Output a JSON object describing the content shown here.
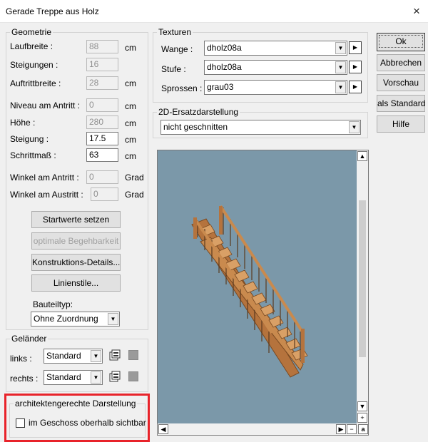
{
  "window": {
    "title": "Gerade Treppe aus Holz",
    "close_glyph": "×"
  },
  "geometrie": {
    "legend": "Geometrie",
    "laufbreite": {
      "label": "Laufbreite :",
      "value": "88",
      "unit": "cm"
    },
    "steigungen": {
      "label": "Steigungen :",
      "value": "16"
    },
    "auftrittbreite": {
      "label": "Auftrittbreite :",
      "value": "28",
      "unit": "cm"
    },
    "niveau": {
      "label": "Niveau am Antritt :",
      "value": "0",
      "unit": "cm"
    },
    "hoehe": {
      "label": "Höhe :",
      "value": "280",
      "unit": "cm"
    },
    "steigung": {
      "label": "Steigung :",
      "value": "17.5",
      "unit": "cm"
    },
    "schrittmass": {
      "label": "Schrittmaß :",
      "value": "63",
      "unit": "cm"
    },
    "winkel_antritt": {
      "label": "Winkel am Antritt :",
      "value": "0",
      "unit": "Grad"
    },
    "winkel_austritt": {
      "label": "Winkel am Austritt :",
      "value": "0",
      "unit": "Grad"
    },
    "startwerte_label": "Startwerte setzen",
    "begehbarkeit_label": "optimale Begehbarkeit",
    "konstruktion_label": "Konstruktions-Details...",
    "linienstile_label": "Linienstile...",
    "bauteiltyp_label": "Bauteiltyp:",
    "bauteiltyp_value": "Ohne Zuordnung"
  },
  "gelaender": {
    "legend": "Geländer",
    "links_label": "links :",
    "links_value": "Standard",
    "rechts_label": "rechts :",
    "rechts_value": "Standard"
  },
  "architekten": {
    "legend": "architektengerechte Darstellung",
    "checkbox_label": "im Geschoss oberhalb sichtbar",
    "checked": false
  },
  "texturen": {
    "legend": "Texturen",
    "wange": {
      "label": "Wange :",
      "value": "dholz08a"
    },
    "stufe": {
      "label": "Stufe :",
      "value": "dholz08a"
    },
    "sprossen": {
      "label": "Sprossen :",
      "value": "grau03"
    }
  },
  "ersatz": {
    "legend": "2D-Ersatzdarstellung",
    "value": "nicht geschnitten"
  },
  "buttons": {
    "ok": "Ok",
    "abbrechen": "Abbrechen",
    "vorschau": "Vorschau",
    "als_standard": "als Standard",
    "hilfe": "Hilfe"
  },
  "preview": {
    "background": "#7b98a9",
    "wood": "#c98a4e",
    "corner_label": "a"
  },
  "colors": {
    "highlight": "#e8232a"
  }
}
